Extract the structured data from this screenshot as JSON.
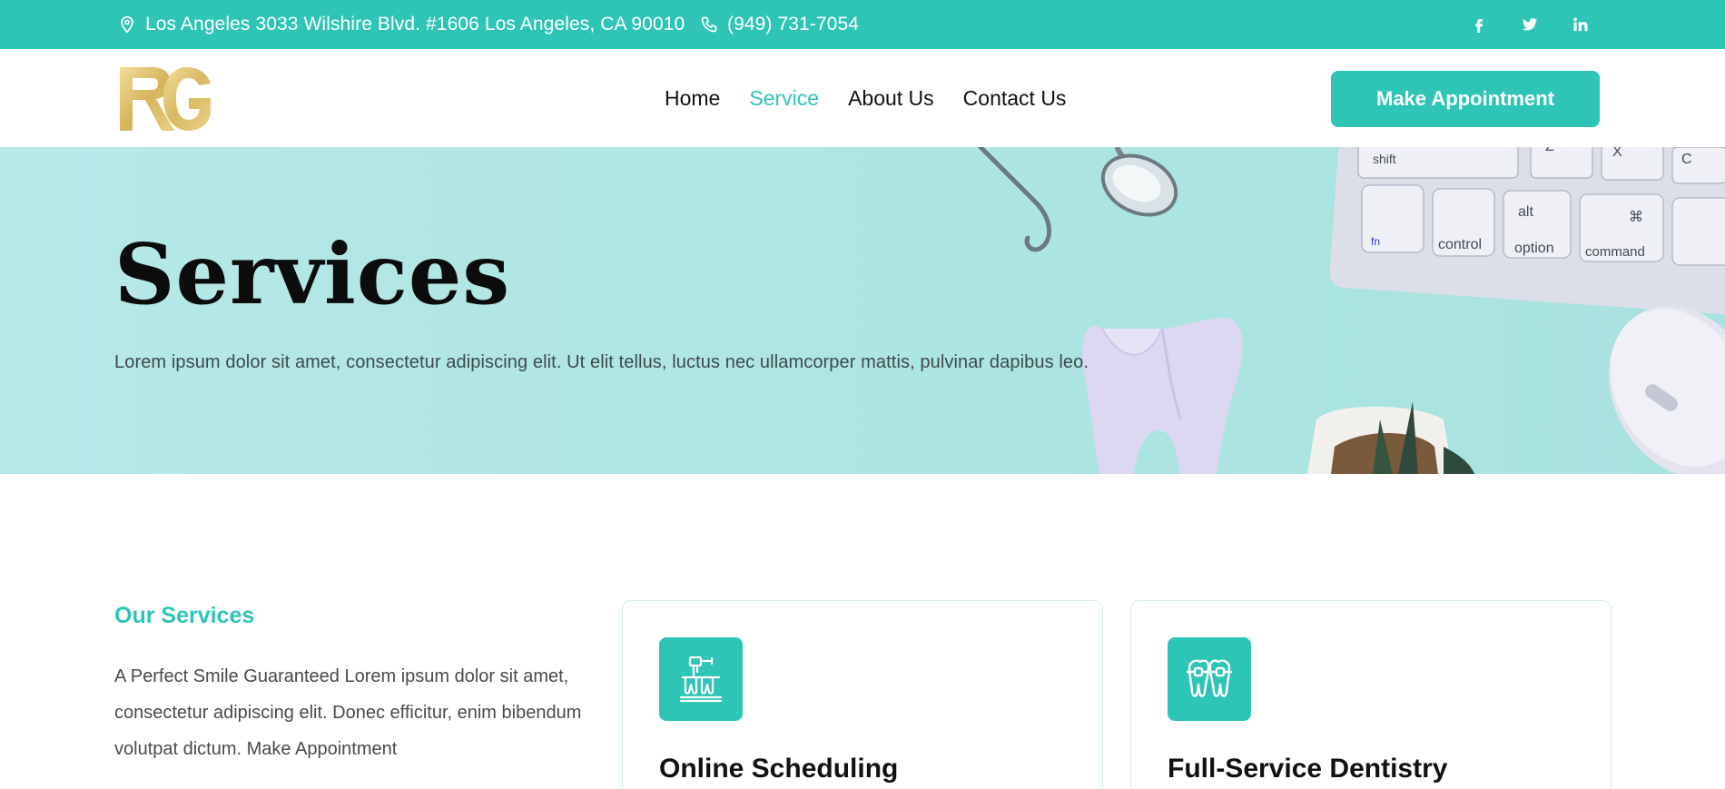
{
  "topbar": {
    "address": "Los Angeles 3033 Wilshire Blvd. #1606 Los Angeles, CA 90010",
    "phone": "(949) 731-7054",
    "socials": [
      "facebook-icon",
      "twitter-icon",
      "linkedin-icon"
    ]
  },
  "header": {
    "logo_text": "RG",
    "nav": [
      {
        "label": "Home",
        "active": false
      },
      {
        "label": "Service",
        "active": true
      },
      {
        "label": "About Us",
        "active": false
      },
      {
        "label": "Contact Us",
        "active": false
      }
    ],
    "cta_label": "Make Appointment"
  },
  "hero": {
    "title": "Services",
    "subtitle": "Lorem ipsum dolor sit amet, consectetur adipiscing elit. Ut elit tellus, luctus nec ullamcorper mattis, pulvinar dapibus leo.",
    "keyboard_keys": [
      "shift",
      "fn",
      "control",
      "alt",
      "option",
      "⌘",
      "command",
      "Z",
      "X",
      "C"
    ]
  },
  "services": {
    "eyebrow": "Our Services",
    "intro": "A Perfect Smile Guaranteed Lorem ipsum dolor sit amet, consectetur adipiscing elit. Donec efficitur, enim bibendum volutpat dictum. Make Appointment",
    "cards": [
      {
        "title": "Online Scheduling",
        "icon": "dental-chair-icon"
      },
      {
        "title": "Full-Service Dentistry",
        "icon": "braces-teeth-icon"
      }
    ]
  },
  "colors": {
    "accent": "#2ec5b6",
    "hero_bg": "#ade5e2",
    "logo_gold": "#d9b860"
  }
}
